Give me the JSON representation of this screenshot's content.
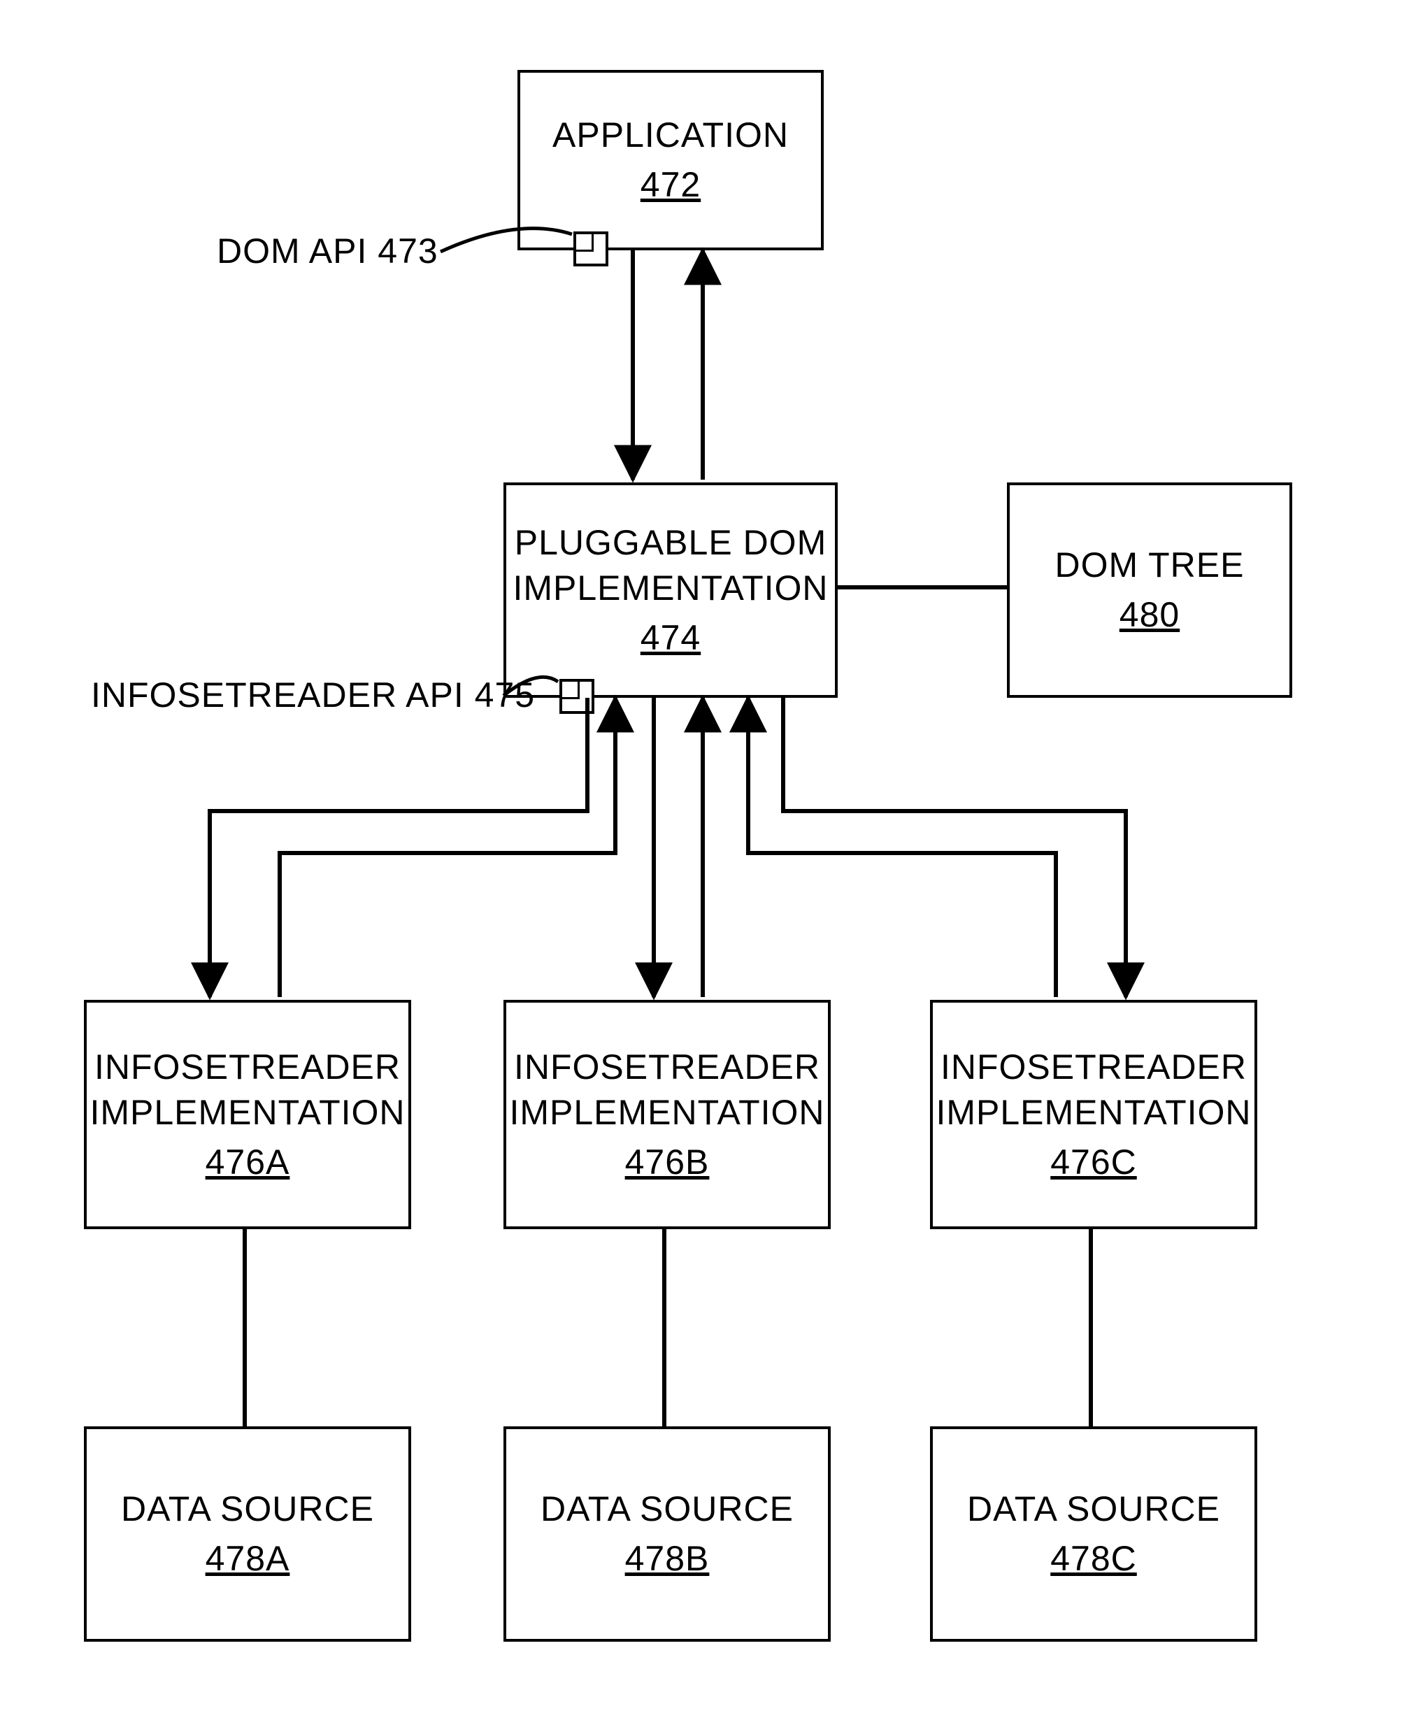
{
  "nodes": {
    "application": {
      "label": "APPLICATION",
      "ref": "472"
    },
    "pluggable": {
      "label": "PLUGGABLE DOM\nIMPLEMENTATION",
      "ref": "474"
    },
    "domtree": {
      "label": "DOM TREE",
      "ref": "480"
    },
    "readerA": {
      "label": "INFOSETREADER\nIMPLEMENTATION",
      "ref": "476A"
    },
    "readerB": {
      "label": "INFOSETREADER\nIMPLEMENTATION",
      "ref": "476B"
    },
    "readerC": {
      "label": "INFOSETREADER\nIMPLEMENTATION",
      "ref": "476C"
    },
    "sourceA": {
      "label": "DATA SOURCE",
      "ref": "478A"
    },
    "sourceB": {
      "label": "DATA SOURCE",
      "ref": "478B"
    },
    "sourceC": {
      "label": "DATA SOURCE",
      "ref": "478C"
    }
  },
  "api": {
    "dom": {
      "label": "DOM API 473"
    },
    "infoset": {
      "label": "INFOSETREADER API 475"
    }
  }
}
